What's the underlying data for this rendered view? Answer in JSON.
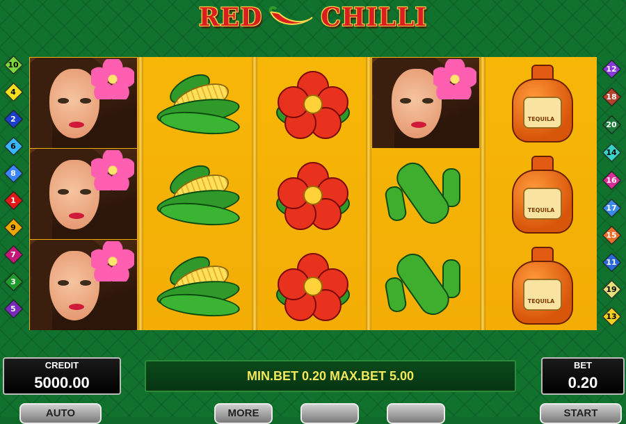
{
  "title": {
    "word1": "RED",
    "word2": "CHILLI",
    "chili_icon": "chili-pepper-icon"
  },
  "reels": [
    [
      "lady",
      "lady",
      "lady"
    ],
    [
      "corn",
      "corn",
      "corn"
    ],
    [
      "red-flower",
      "red-flower",
      "red-flower"
    ],
    [
      "lady",
      "cactus",
      "cactus"
    ],
    [
      "tequila",
      "tequila",
      "tequila"
    ]
  ],
  "tequila_label": "TEQUILA",
  "paylines_left": [
    {
      "num": "10",
      "color": "#7ad63a"
    },
    {
      "num": "4",
      "color": "#f2e020"
    },
    {
      "num": "2",
      "color": "#1a3fc8"
    },
    {
      "num": "6",
      "color": "#38b6ff"
    },
    {
      "num": "8",
      "color": "#3a86ff"
    },
    {
      "num": "1",
      "color": "#e01818"
    },
    {
      "num": "9",
      "color": "#f0a800"
    },
    {
      "num": "7",
      "color": "#c3187a"
    },
    {
      "num": "3",
      "color": "#1e9a2a"
    },
    {
      "num": "5",
      "color": "#7a2ab8"
    }
  ],
  "paylines_right": [
    {
      "num": "12",
      "color": "#8a3ad8"
    },
    {
      "num": "18",
      "color": "#b6402a"
    },
    {
      "num": "20",
      "color": "#1a7a38"
    },
    {
      "num": "14",
      "color": "#38d2c8"
    },
    {
      "num": "16",
      "color": "#d8309a"
    },
    {
      "num": "17",
      "color": "#3a8ae8"
    },
    {
      "num": "15",
      "color": "#e8702a"
    },
    {
      "num": "11",
      "color": "#2a6ad8"
    },
    {
      "num": "19",
      "color": "#e6e07a"
    },
    {
      "num": "13",
      "color": "#f0d020"
    }
  ],
  "credit": {
    "label": "CREDIT",
    "value": "5000.00"
  },
  "bet": {
    "label": "BET",
    "value": "0.20"
  },
  "limits": "MIN.BET 0.20 MAX.BET 5.00",
  "buttons": {
    "auto": "AUTO",
    "more": "MORE",
    "start": "START"
  }
}
